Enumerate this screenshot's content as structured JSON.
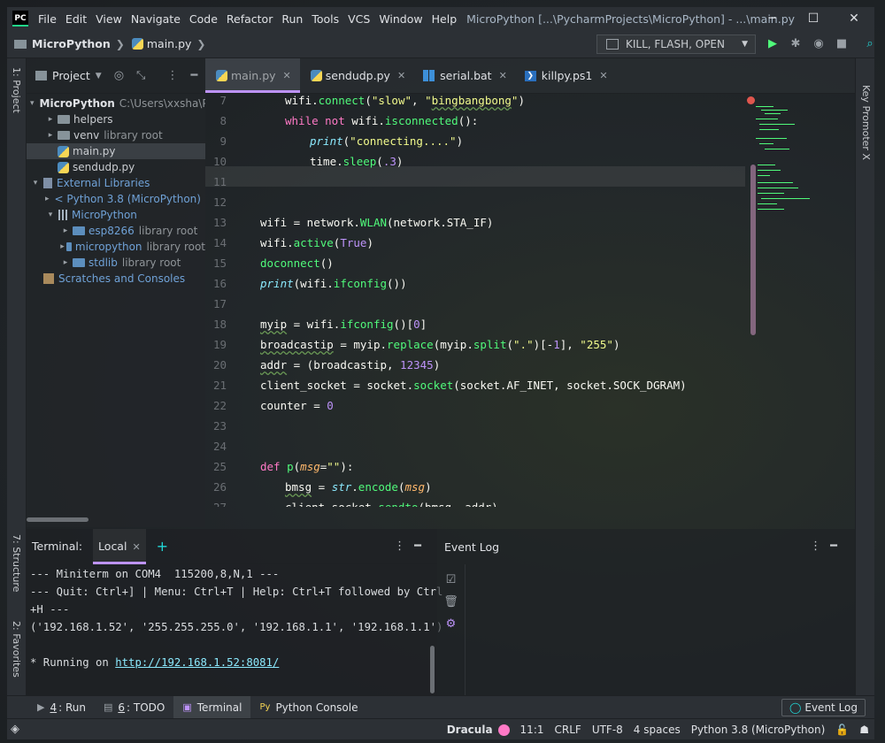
{
  "app": {
    "logo": "PC",
    "menu": [
      "File",
      "Edit",
      "View",
      "Navigate",
      "Code",
      "Refactor",
      "Run",
      "Tools",
      "VCS",
      "Window",
      "Help"
    ],
    "title": "MicroPython [...\\PycharmProjects\\MicroPython] - ...\\main.py",
    "window_controls": [
      "minimize-icon",
      "maximize-icon",
      "close-icon"
    ]
  },
  "navbar": {
    "project": "MicroPython",
    "file": "main.py",
    "run_config": "KILL, FLASH, OPEN",
    "icons": [
      "run-icon",
      "debug-icon",
      "coverage-icon",
      "stop-icon",
      "search-icon"
    ]
  },
  "left_strip": [
    "1: Project",
    "7: Structure",
    "2: Favorites"
  ],
  "right_strip": [
    "Key Promoter X"
  ],
  "project_panel": {
    "title": "Project",
    "tree": [
      {
        "indent": 0,
        "arrow": "▾",
        "icon": "folder",
        "name": "MicroPython",
        "bold": true,
        "path": "C:\\Users\\xxsha\\P"
      },
      {
        "indent": 1,
        "arrow": "▸",
        "icon": "folder",
        "name": "helpers"
      },
      {
        "indent": 1,
        "arrow": "▸",
        "icon": "folder",
        "name": "venv",
        "suffix": "library root"
      },
      {
        "indent": 1,
        "arrow": "",
        "icon": "py",
        "name": "main.py",
        "selected": true
      },
      {
        "indent": 1,
        "arrow": "",
        "icon": "py",
        "name": "sendudp.py"
      },
      {
        "indent": 0,
        "arrow": "▾",
        "icon": "lib",
        "name": "External Libraries",
        "blue": true
      },
      {
        "indent": 1,
        "arrow": "▸",
        "icon": "py",
        "name": "< Python 3.8 (MicroPython) >",
        "blue": true
      },
      {
        "indent": 1,
        "arrow": "▾",
        "icon": "libbars",
        "name": "MicroPython",
        "blue": true
      },
      {
        "indent": 2,
        "arrow": "▸",
        "icon": "folder-blue",
        "name": "esp8266",
        "suffix": "library root",
        "blue": true
      },
      {
        "indent": 2,
        "arrow": "▸",
        "icon": "folder-blue",
        "name": "micropython",
        "suffix": "library root",
        "blue": true
      },
      {
        "indent": 2,
        "arrow": "▸",
        "icon": "folder-blue",
        "name": "stdlib",
        "suffix": "library root",
        "blue": true
      },
      {
        "indent": 0,
        "arrow": "",
        "icon": "scratch",
        "name": "Scratches and Consoles",
        "blue": true
      }
    ]
  },
  "editor": {
    "tabs": [
      {
        "label": "main.py",
        "icon": "py",
        "active": true
      },
      {
        "label": "sendudp.py",
        "icon": "py"
      },
      {
        "label": "serial.bat",
        "icon": "bat"
      },
      {
        "label": "killpy.ps1",
        "icon": "ps"
      }
    ],
    "line_numbers": [
      "7",
      "8",
      "9",
      "10",
      "11",
      "12",
      "13",
      "14",
      "15",
      "16",
      "17",
      "18",
      "19",
      "20",
      "21",
      "22",
      "23",
      "24",
      "25",
      "26",
      "27"
    ],
    "current_line": "11"
  },
  "terminal": {
    "label": "Terminal:",
    "tab": "Local",
    "lines": [
      "--- Miniterm on COM4  115200,8,N,1 ---",
      "--- Quit: Ctrl+] | Menu: Ctrl+T | Help: Ctrl+T followed by Ctrl",
      "+H ---",
      "('192.168.1.52', '255.255.255.0', '192.168.1.1', '192.168.1.1')",
      "",
      "* Running on "
    ],
    "link": "http://192.168.1.52:8081/"
  },
  "event_log": {
    "title": "Event Log"
  },
  "tool_windows": [
    {
      "key": "4",
      "label": ": Run",
      "icon": "run-icon"
    },
    {
      "key": "6",
      "label": ": TODO",
      "icon": "todo-icon"
    },
    {
      "key": "",
      "label": "Terminal",
      "icon": "terminal-icon",
      "active": true
    },
    {
      "key": "",
      "label": "Python Console",
      "icon": "python-console-icon"
    }
  ],
  "event_log_button": "Event Log",
  "status": {
    "theme": "Dracula",
    "position": "11:1",
    "line_sep": "CRLF",
    "encoding": "UTF-8",
    "indent": "4 spaces",
    "interpreter": "Python 3.8 (MicroPython)"
  },
  "colors": {
    "accent": "#bd93f9",
    "keyword": "#ff79c6",
    "string": "#f1fa8c",
    "function": "#50fa7b",
    "number": "#bd93f9",
    "builtin": "#8be9fd",
    "param": "#ffb86c"
  }
}
